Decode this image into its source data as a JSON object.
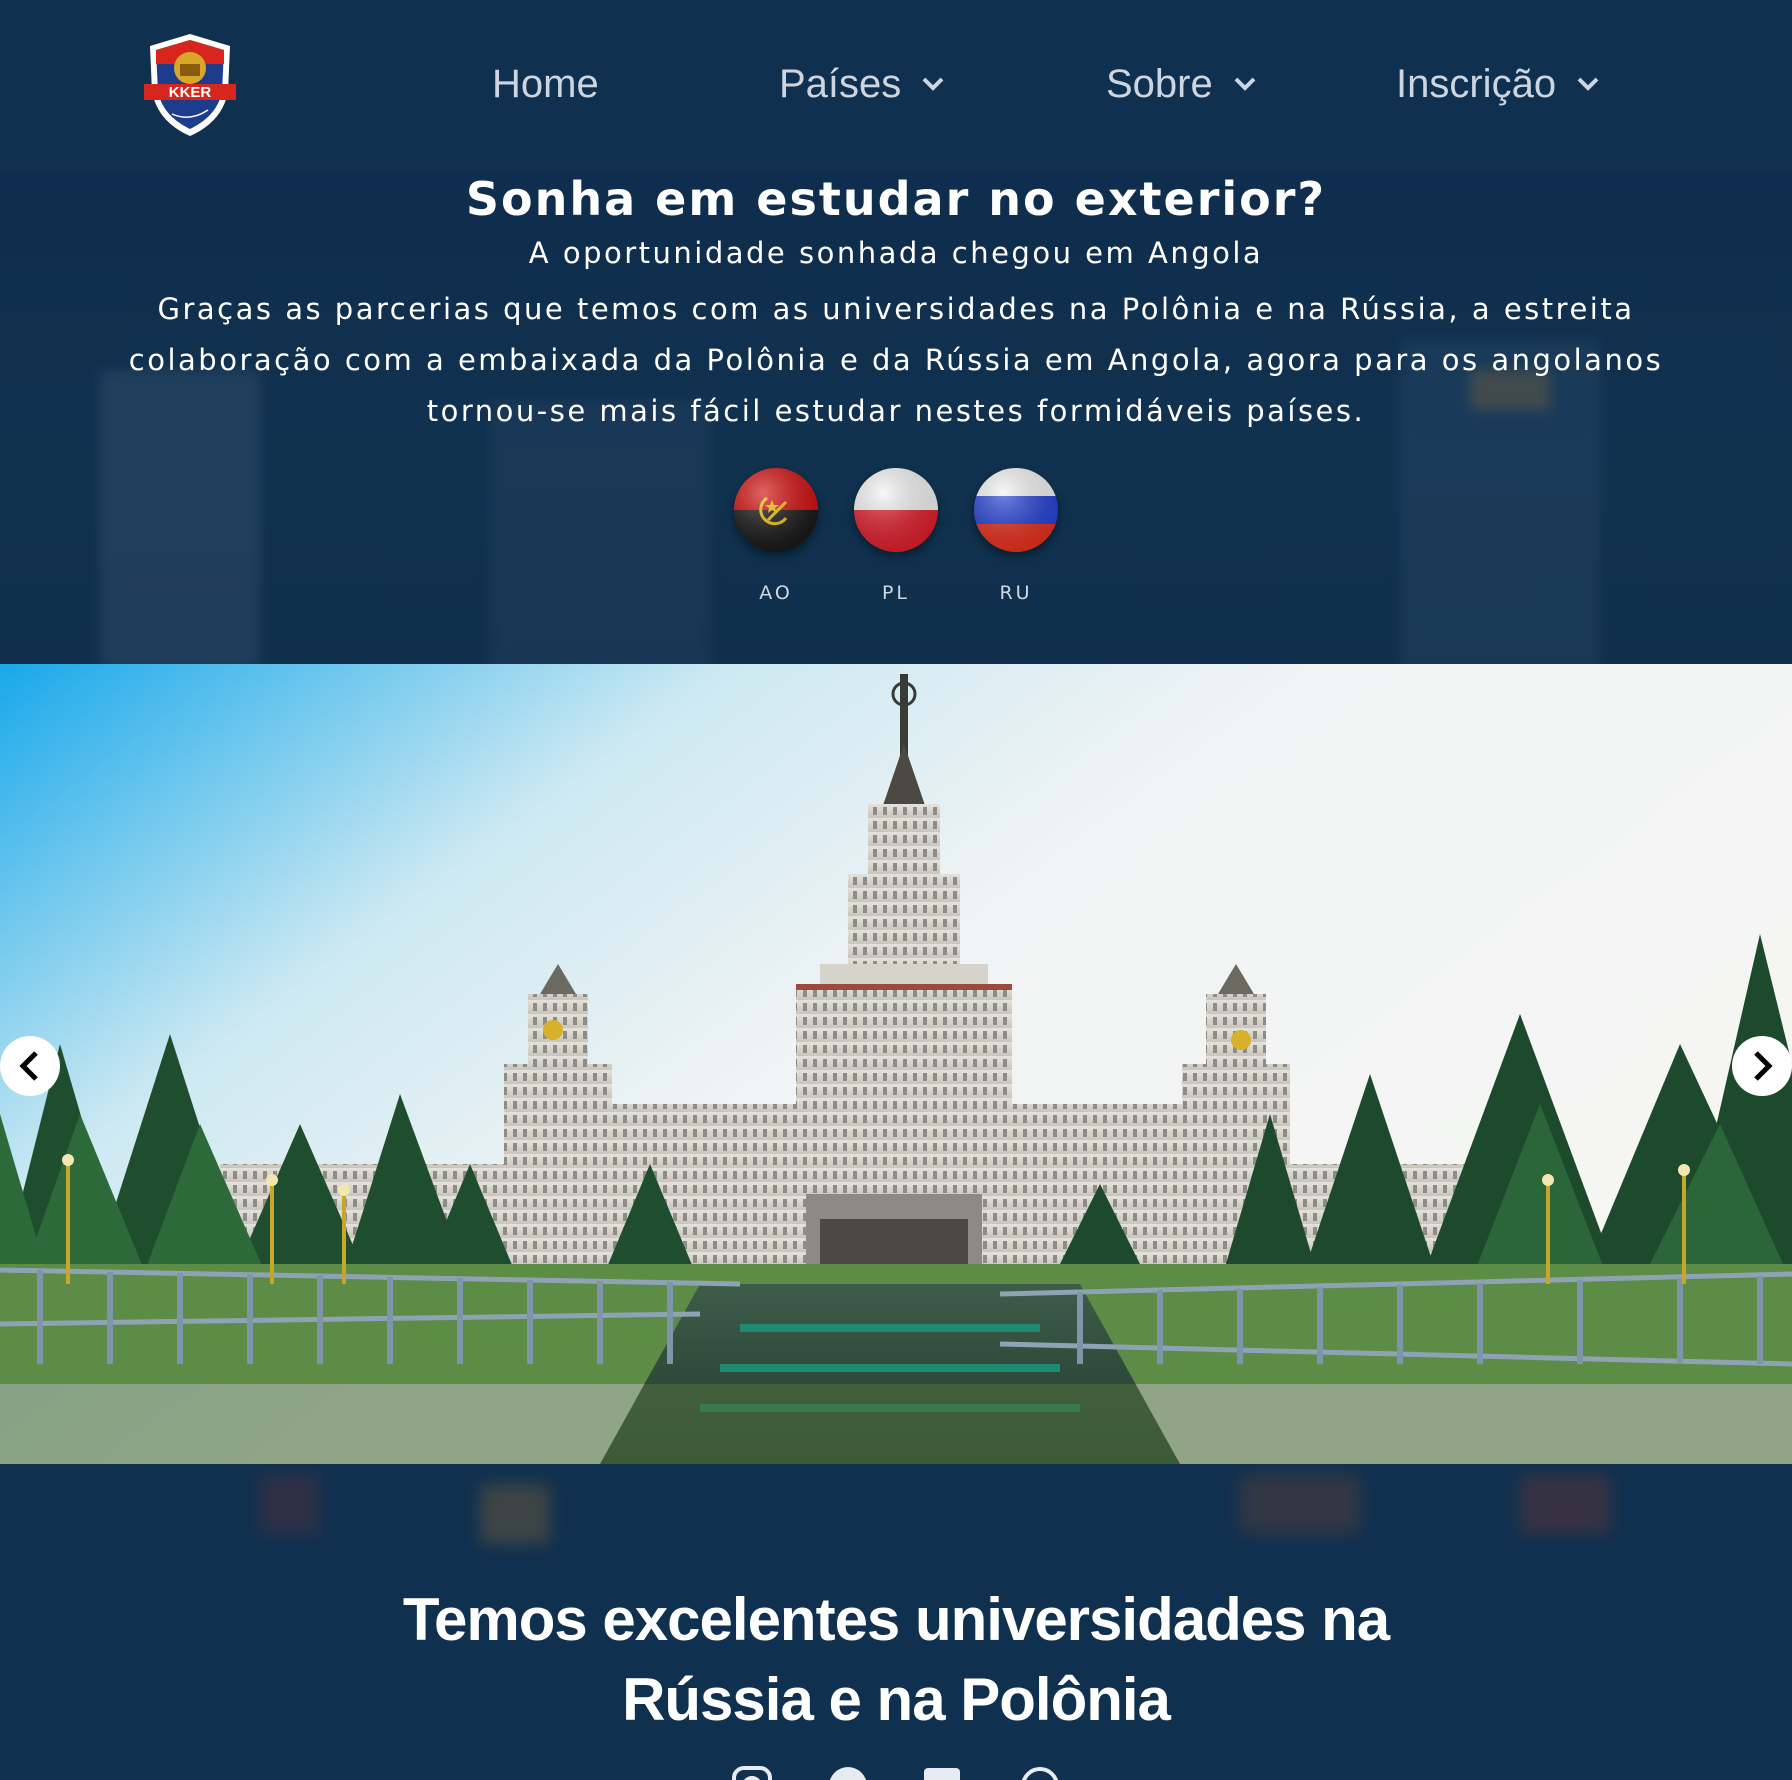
{
  "header": {
    "logo_text": "KKER",
    "nav": [
      {
        "label": "Home",
        "has_dropdown": false
      },
      {
        "label": "Países",
        "has_dropdown": true
      },
      {
        "label": "Sobre",
        "has_dropdown": true
      },
      {
        "label": "Inscrição",
        "has_dropdown": true
      }
    ]
  },
  "hero": {
    "title": "Sonha em estudar no exterior?",
    "subtitle": "A oportunidade sonhada chegou em Angola",
    "body": "Graças as parcerias que temos com as universidades na Polônia e na Rússia, a estreita colaboração com a embaixada da Polônia e da Rússia em Angola, agora para os angolanos tornou-se mais fácil estudar nestes formidáveis países.",
    "flags": [
      {
        "code": "AO",
        "icon": "angola-flag-icon"
      },
      {
        "code": "PL",
        "icon": "poland-flag-icon"
      },
      {
        "code": "RU",
        "icon": "russia-flag-icon"
      }
    ]
  },
  "slider": {
    "prev_icon": "chevron-left-icon",
    "next_icon": "chevron-right-icon"
  },
  "section": {
    "title_line1": "Temos excelentes universidades na",
    "title_line2": "Rússia e na Polônia"
  },
  "social_icons": [
    "instagram-icon",
    "facebook-icon",
    "linkedin-icon",
    "whatsapp-icon"
  ],
  "colors": {
    "primary_bg": "#0f2d4e",
    "header_bg": "#10304f",
    "nav_text": "#cdd6e0",
    "logo_red": "#d7261e",
    "logo_blue": "#1e3c8c"
  }
}
